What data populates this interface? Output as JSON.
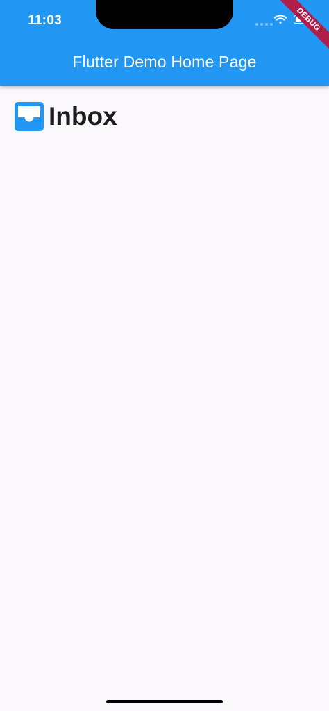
{
  "status_bar": {
    "time": "11:03"
  },
  "app_bar": {
    "title": "Flutter Demo Home Page"
  },
  "debug_banner": {
    "label": "DEBUG"
  },
  "main": {
    "inbox_label": "Inbox",
    "inbox_icon": "inbox-icon"
  },
  "colors": {
    "primary": "#2196f3",
    "background": "#faf8fb",
    "text": "#1c1b1f",
    "debug": "#b01e4a"
  }
}
